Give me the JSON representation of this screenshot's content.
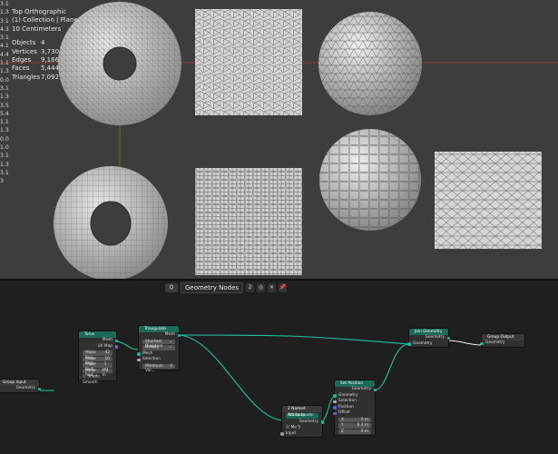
{
  "viewport": {
    "view_name": "Top Orthographic",
    "collection": "(1) Collection | Plane",
    "scale": "10 Centimeters",
    "stats": [
      {
        "label": "Objects",
        "value": "4"
      },
      {
        "label": "Vertices",
        "value": "3,730"
      },
      {
        "label": "Edges",
        "value": "9,166"
      },
      {
        "label": "Faces",
        "value": "5,444"
      },
      {
        "label": "Triangles",
        "value": "7,092"
      }
    ],
    "gutter_numbers": [
      "3.1",
      "1.3",
      "3.1",
      "4.3",
      "3.1",
      "4.1",
      "4.4",
      "1.1",
      "1.3",
      "0.0",
      "3.1",
      "1.3",
      "3.5",
      "5.4",
      "1.1",
      "1.3",
      "0.0",
      "1.0",
      "3.1",
      "1.3",
      "3.1",
      "3"
    ]
  },
  "node_editor": {
    "title": "Geometry Nodes",
    "users": "2",
    "nodes": {
      "group_input": {
        "title": "Group Input",
        "outputs": [
          "Geometry"
        ]
      },
      "torus": {
        "title": "Torus",
        "outputs": [
          "Mesh",
          "UV Map"
        ],
        "fields": [
          {
            "label": "Major Seg...",
            "value": "42"
          },
          {
            "label": "Minor Seg...",
            "value": "16"
          },
          {
            "label": "Major Radi...",
            "value": "1 m"
          },
          {
            "label": "Minor Radi...",
            "value": "0.2 m"
          }
        ],
        "checkbox": "Shade Smooth"
      },
      "triangulate": {
        "title": "Triangulate",
        "outputs": [
          "Mesh"
        ],
        "dropdowns": [
          "Shortest Diagonal",
          "Beauty"
        ],
        "inputs": [
          "Mesh",
          "Selection"
        ],
        "field": {
          "label": "Minimum Ver...",
          "value": "4"
        }
      },
      "named_attr": {
        "title": "Named Attribute",
        "prefix": "2",
        "data_field": "tris to quads",
        "outputs": [
          "Geometry"
        ],
        "inputs": [
          "Input"
        ],
        "small": [
          "Me",
          "5"
        ]
      },
      "set_position": {
        "title": "Set Position",
        "outputs": [
          "Geometry"
        ],
        "inputs": [
          "Geometry",
          "Selection",
          "Position",
          "Offset"
        ],
        "vector": [
          {
            "axis": "X",
            "value": "0 m"
          },
          {
            "axis": "Y",
            "value": "0.3 m"
          },
          {
            "axis": "Z",
            "value": "0 m"
          }
        ]
      },
      "join_geometry": {
        "title": "Join Geometry",
        "outputs": [
          "Geometry"
        ],
        "inputs": [
          "Geometry"
        ]
      },
      "group_output": {
        "title": "Group Output",
        "inputs": [
          "Geometry"
        ]
      }
    }
  },
  "colors": {
    "geometry_socket": "#16c09a",
    "geometry_header": "#1a6a56",
    "viewport_bg": "#3d3d3d"
  }
}
